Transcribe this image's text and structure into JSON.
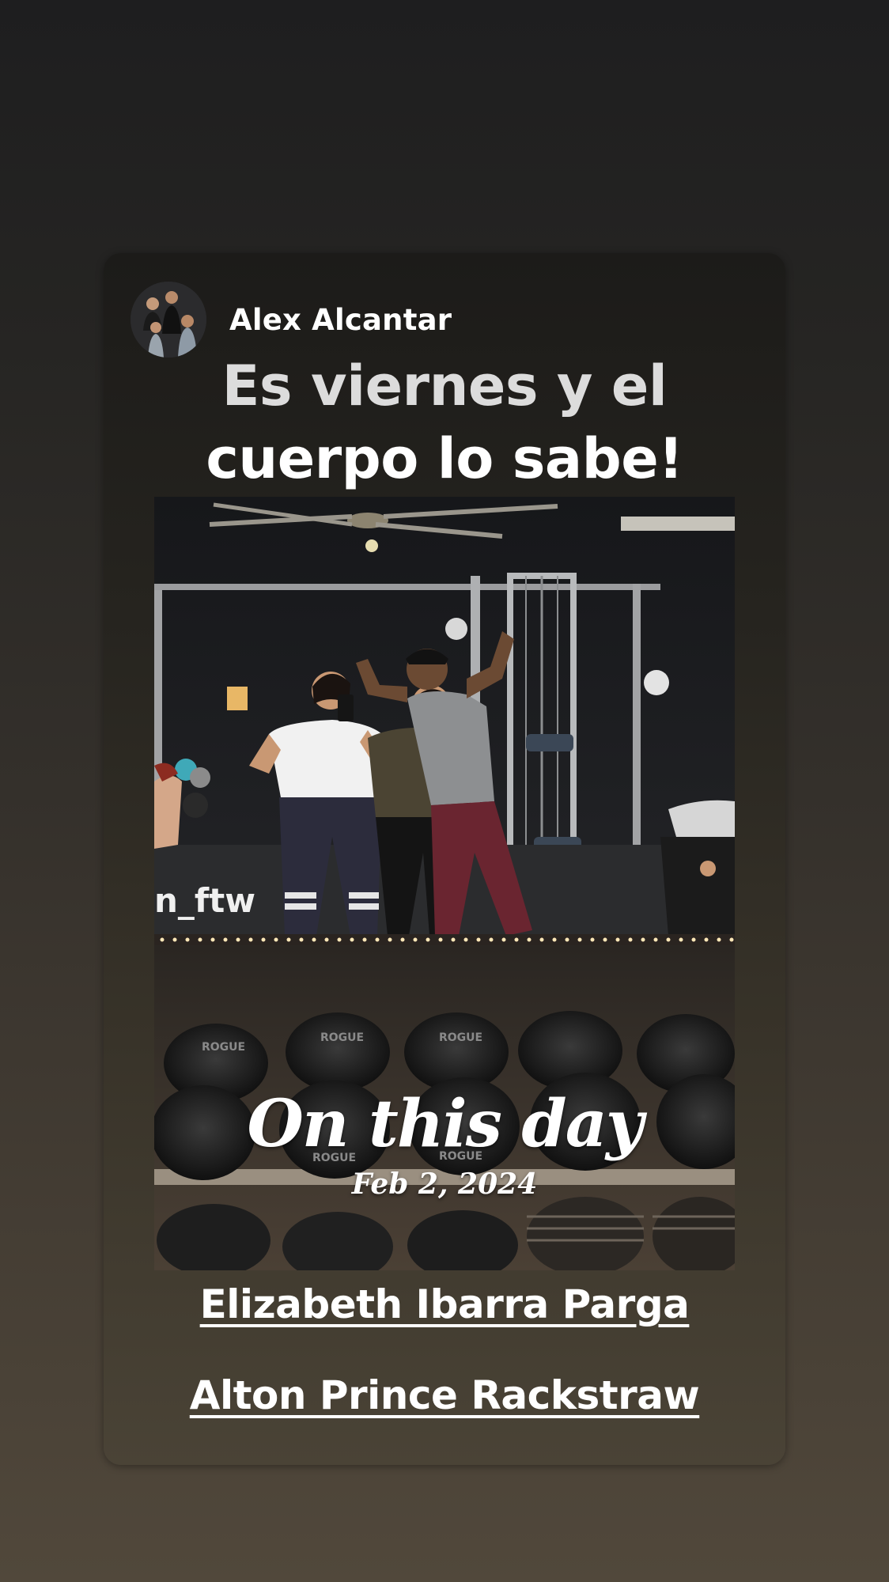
{
  "story": {
    "author_name": "Alex Alcantar",
    "caption_line1": "Es viernes y el",
    "caption_line2": "cuerpo lo sabe!",
    "memory_title": "On this day",
    "memory_date": "Feb 2, 2024",
    "mentions": [
      "Elizabeth Ibarra Parga",
      "Alton Prince Rackstraw"
    ],
    "photo_wall_text": "n_ftw",
    "plate_brand": "ROGUE"
  },
  "colors": {
    "background_top": "#1e1e1f",
    "background_bottom": "#51483b",
    "text": "#ffffff"
  }
}
